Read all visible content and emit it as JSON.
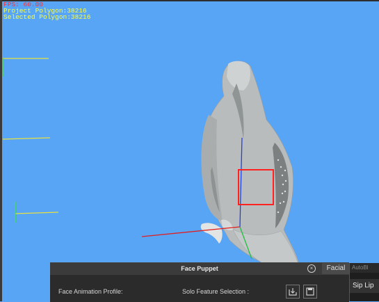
{
  "viewport": {
    "fps": "FPS: 60.00",
    "project_polygon": "Project Polygon:38216",
    "selected_polygon": "Selected Polygon:38216"
  },
  "panel": {
    "title": "Face Puppet",
    "close_icon": "close-icon",
    "tab_label": "Facial",
    "profile_label": "Face Animation Profile:",
    "solo_label": "Solo Feature Selection :",
    "load_icon": "load-profile-icon",
    "save_icon": "save-icon"
  },
  "side_panel": {
    "top_text": "AutoBl",
    "sip_lip_label": "Sip Lip"
  },
  "colors": {
    "viewport_bg": "#58a5f6",
    "selection_box": "#ff2020"
  }
}
